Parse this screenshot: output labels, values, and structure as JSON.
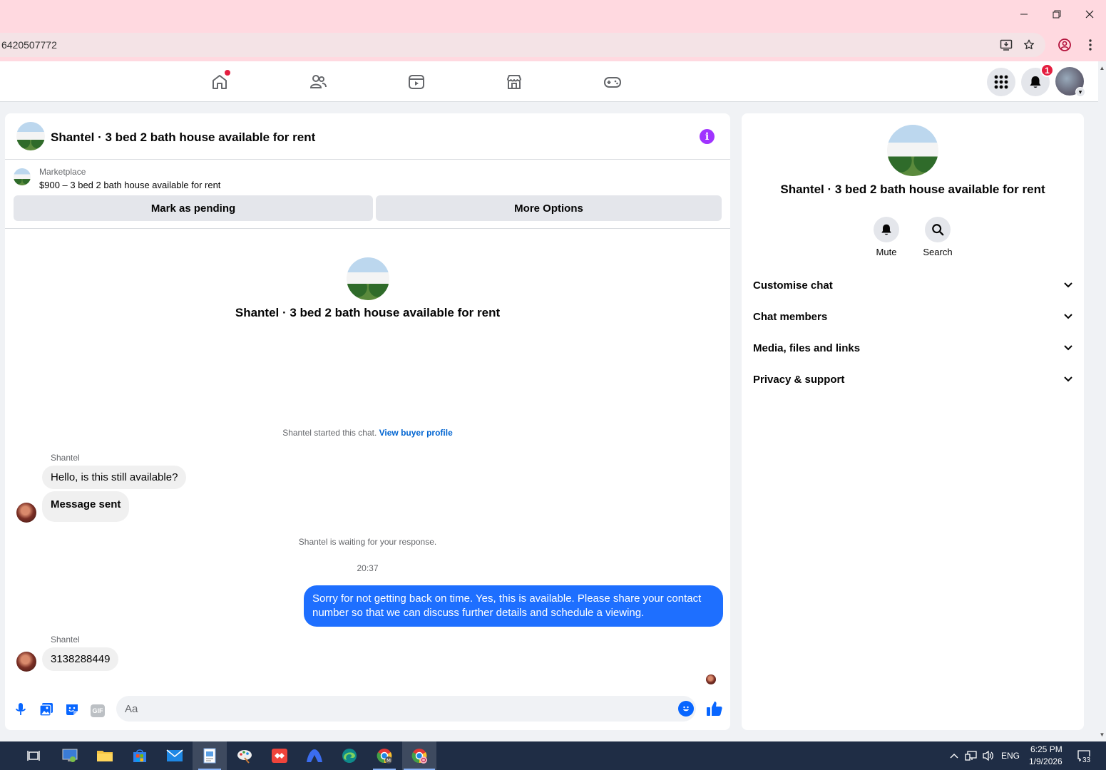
{
  "browser": {
    "url": "6420507772",
    "window_controls": [
      "minimize",
      "restore",
      "close"
    ]
  },
  "nav": {
    "notifications_count": "1"
  },
  "chat": {
    "header_title": "Shantel · 3 bed 2 bath house available for rent",
    "marketplace_label": "Marketplace",
    "listing": "$900 – 3 bed 2 bath house available for rent",
    "mark_pending_label": "Mark as pending",
    "more_options_label": "More Options",
    "center_title": "Shantel · 3 bed 2 bath house available for rent",
    "started_text": "Shantel started this chat.",
    "view_buyer_profile": "View buyer profile",
    "messages": [
      {
        "sender": "Shantel",
        "text": "Hello, is this still available?"
      },
      {
        "text": "Message sent"
      },
      {
        "system": "Shantel is waiting for your response."
      },
      {
        "time": "20:37"
      },
      {
        "outgoing": "Sorry for not getting back on time. Yes, this is available. Please share your contact number so that we can discuss further details and schedule a viewing."
      },
      {
        "sender": "Shantel",
        "text": "3138288449"
      }
    ],
    "input_placeholder": "Aa"
  },
  "info_panel": {
    "title": "Shantel · 3 bed 2 bath house available for rent",
    "actions": [
      {
        "label": "Mute",
        "icon": "bell-icon"
      },
      {
        "label": "Search",
        "icon": "search-icon"
      }
    ],
    "sections": [
      "Customise chat",
      "Chat members",
      "Media, files and links",
      "Privacy & support"
    ]
  },
  "taskbar": {
    "language": "ENG",
    "time": "6:25 PM",
    "date": "1/9/2026",
    "notification_count": "33"
  },
  "colors": {
    "accent": "#0866ff",
    "outgoing_bubble": "#1e6fff",
    "chrome": "#ffd9e0",
    "info_icon": "#a033ff"
  }
}
